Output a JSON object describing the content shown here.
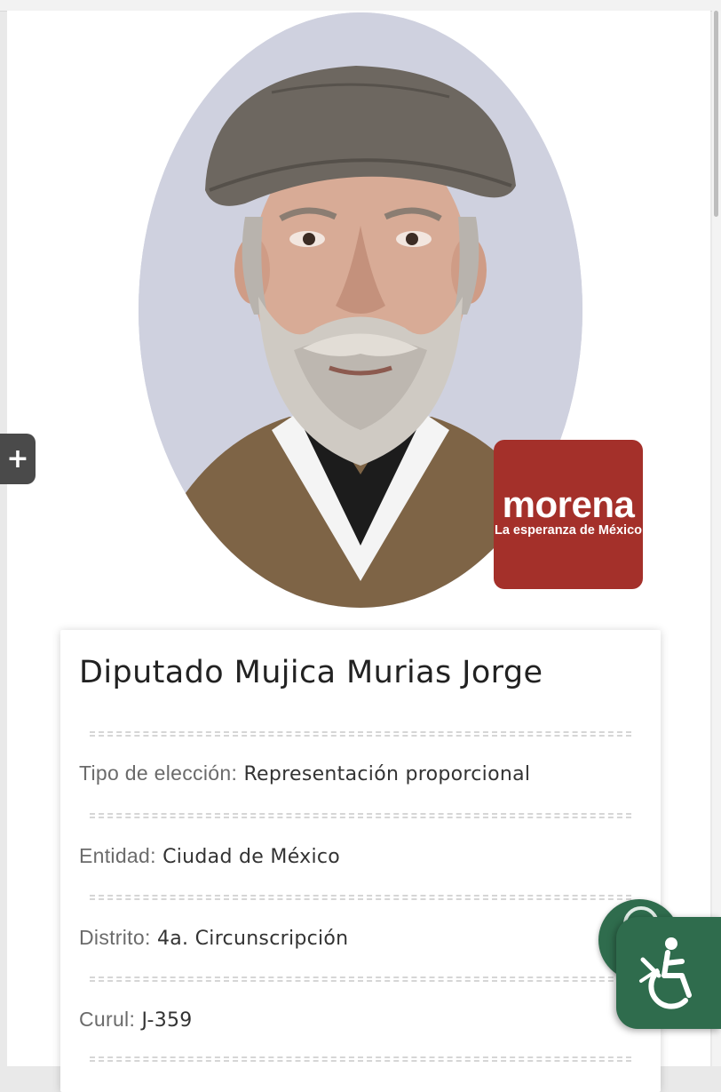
{
  "party": {
    "name": "morena",
    "slogan": "La esperanza de México",
    "brand_color": "#a4302a"
  },
  "profile": {
    "title": "Diputado Mujica Murias Jorge",
    "fields": [
      {
        "label": "Tipo de elección:",
        "value": "Representación proporcional"
      },
      {
        "label": "Entidad:",
        "value": "Ciudad de México"
      },
      {
        "label": "Distrito:",
        "value": "4a. Circunscripción"
      },
      {
        "label": "Curul:",
        "value": "J-359"
      }
    ]
  },
  "controls": {
    "expand_tab_symbol": "+",
    "accessibility_icon": "wheelchair-icon",
    "chat_icon": "chat-icon"
  },
  "colors": {
    "accessibility_green": "#2f6c4d",
    "photo_background": "#cfd1df"
  }
}
